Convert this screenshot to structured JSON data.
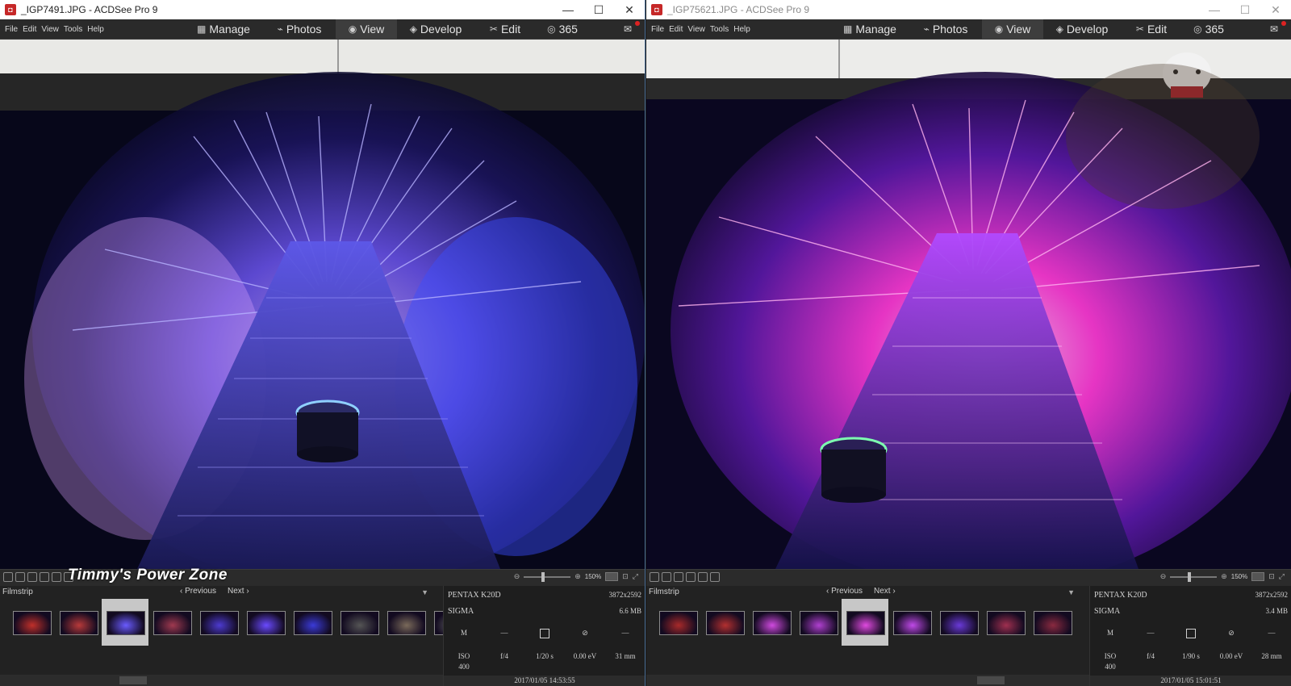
{
  "windows": [
    {
      "title": "_IGP7491.JPG - ACDSee Pro 9",
      "active": true,
      "window_controls": [
        "—",
        "☐",
        "✕"
      ],
      "menu": [
        "File",
        "Edit",
        "View",
        "Tools",
        "Help"
      ],
      "modes": [
        {
          "label": "Manage",
          "icon": "▦"
        },
        {
          "label": "Photos",
          "icon": "⌁"
        },
        {
          "label": "View",
          "icon": "◉"
        },
        {
          "label": "Develop",
          "icon": "◈"
        },
        {
          "label": "Edit",
          "icon": "✂"
        },
        {
          "label": "365",
          "icon": "◎"
        }
      ],
      "active_mode": "View",
      "zoom": "150%",
      "filmstrip": {
        "title": "Filmstrip",
        "previous": "Previous",
        "next": "Next",
        "thumbnail_count": 10,
        "selected_index": 2
      },
      "properties": {
        "camera": "PENTAX K20D",
        "resolution": "3872x2592",
        "lens": "SIGMA",
        "file_size": "6.6 MB",
        "mode": "M",
        "iso": "ISO\n400",
        "aperture": "f/4",
        "shutter": "1/20 s",
        "exposure": "0.00 eV",
        "focal_length": "31 mm",
        "datetime": "2017/01/05 14:53:55",
        "placeholders": [
          "—",
          "—"
        ]
      }
    },
    {
      "title": "_IGP75621.JPG - ACDSee Pro 9",
      "active": false,
      "window_controls": [
        "—",
        "☐",
        "✕"
      ],
      "menu": [
        "File",
        "Edit",
        "View",
        "Tools",
        "Help"
      ],
      "modes": [
        {
          "label": "Manage",
          "icon": "▦"
        },
        {
          "label": "Photos",
          "icon": "⌁"
        },
        {
          "label": "View",
          "icon": "◉"
        },
        {
          "label": "Develop",
          "icon": "◈"
        },
        {
          "label": "Edit",
          "icon": "✂"
        },
        {
          "label": "365",
          "icon": "◎"
        }
      ],
      "active_mode": "View",
      "zoom": "150%",
      "filmstrip": {
        "title": "Filmstrip",
        "previous": "Previous",
        "next": "Next",
        "thumbnail_count": 9,
        "selected_index": 4
      },
      "properties": {
        "camera": "PENTAX K20D",
        "resolution": "3872x2592",
        "lens": "SIGMA",
        "file_size": "3.4 MB",
        "mode": "M",
        "iso": "ISO\n400",
        "aperture": "f/4",
        "shutter": "1/90 s",
        "exposure": "0.00 eV",
        "focal_length": "28 mm",
        "datetime": "2017/01/05 15:01:51",
        "placeholders": [
          "—",
          "—"
        ]
      }
    }
  ],
  "watermark": "Timmy's Power Zone",
  "colors": {
    "accent_border": "#4a6e95",
    "left_fireworks": "#5a4dff",
    "right_fireworks": "#ff3ad6"
  }
}
